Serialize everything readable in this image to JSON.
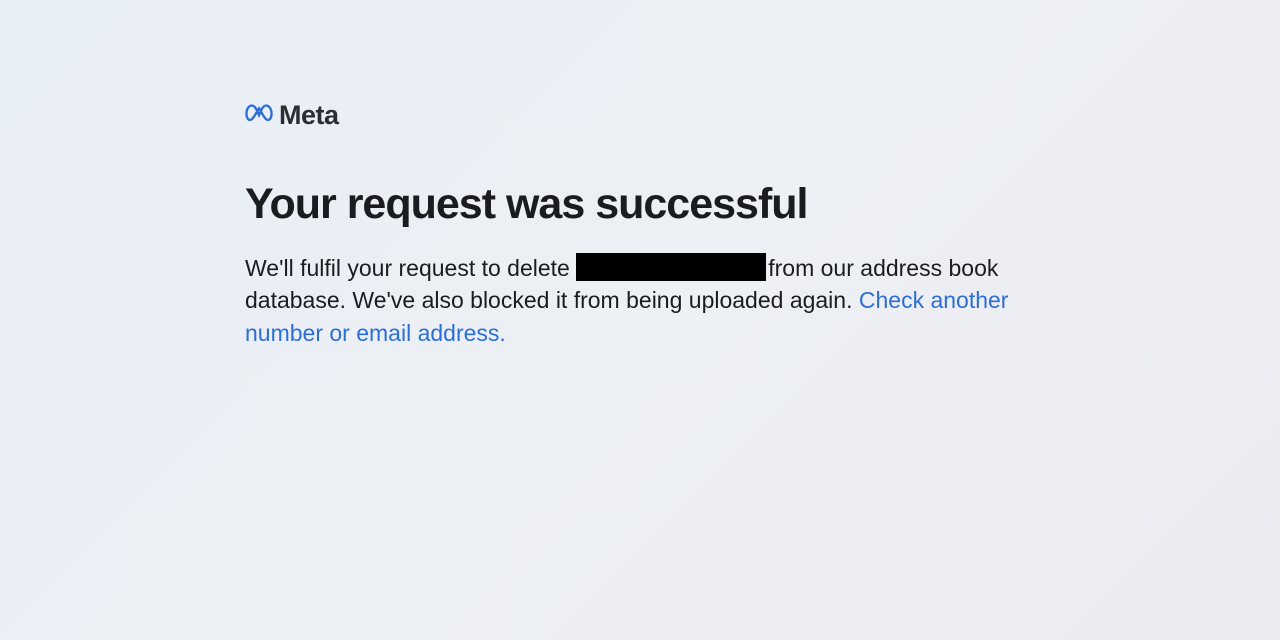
{
  "brand": {
    "name": "Meta"
  },
  "main": {
    "heading": "Your request was successful",
    "body_before_redacted": "We'll fulfil your request to delete ",
    "body_after_redacted": "from our address book database. We've also blocked it from being uploaded again. ",
    "link_text": "Check another number or email address."
  }
}
